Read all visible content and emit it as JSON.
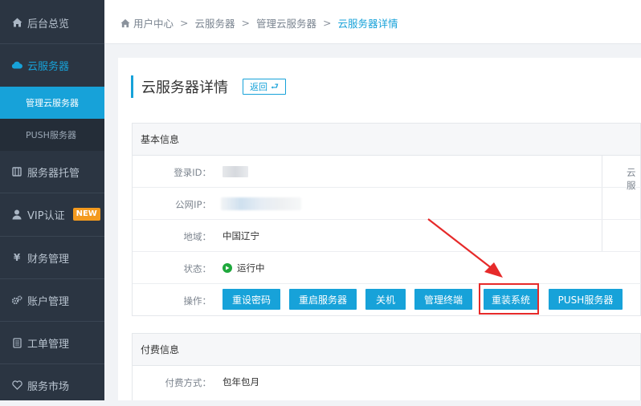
{
  "sidebar": {
    "items": [
      {
        "label": "后台总览",
        "icon": "home-icon"
      },
      {
        "label": "云服务器",
        "icon": "cloud-icon"
      },
      {
        "label": "服务器托管",
        "icon": "server-icon"
      },
      {
        "label": "VIP认证",
        "icon": "user-icon",
        "badge": "NEW"
      },
      {
        "label": "财务管理",
        "icon": "yen-icon"
      },
      {
        "label": "账户管理",
        "icon": "gears-icon"
      },
      {
        "label": "工单管理",
        "icon": "ticket-icon"
      },
      {
        "label": "服务市场",
        "icon": "heart-icon"
      }
    ],
    "subitems": [
      {
        "label": "管理云服务器"
      },
      {
        "label": "PUSH服务器"
      }
    ]
  },
  "breadcrumb": {
    "items": [
      "用户中心",
      "云服务器",
      "管理云服务器"
    ],
    "current": "云服务器详情",
    "separator": ">"
  },
  "page": {
    "title": "云服务器详情",
    "back_label": "返回"
  },
  "basic_info": {
    "heading": "基本信息",
    "login_id_label": "登录ID：",
    "public_ip_label": "公网IP：",
    "region_label": "地域：",
    "region_value": "中国辽宁",
    "status_label": "状态：",
    "status_value": "运行中",
    "actions_label": "操作：",
    "side_label_cut": "云服",
    "buttons": [
      "重设密码",
      "重启服务器",
      "关机",
      "管理终端",
      "重装系统",
      "PUSH服务器"
    ]
  },
  "billing_info": {
    "heading": "付费信息",
    "pay_method_label": "付费方式：",
    "pay_method_value": "包年包月"
  },
  "colors": {
    "accent": "#17a2d9",
    "sidebar_bg": "#2b3542",
    "status_green": "#1ea83c",
    "annotation_red": "#e62a2a",
    "badge_orange": "#f39a1e"
  }
}
